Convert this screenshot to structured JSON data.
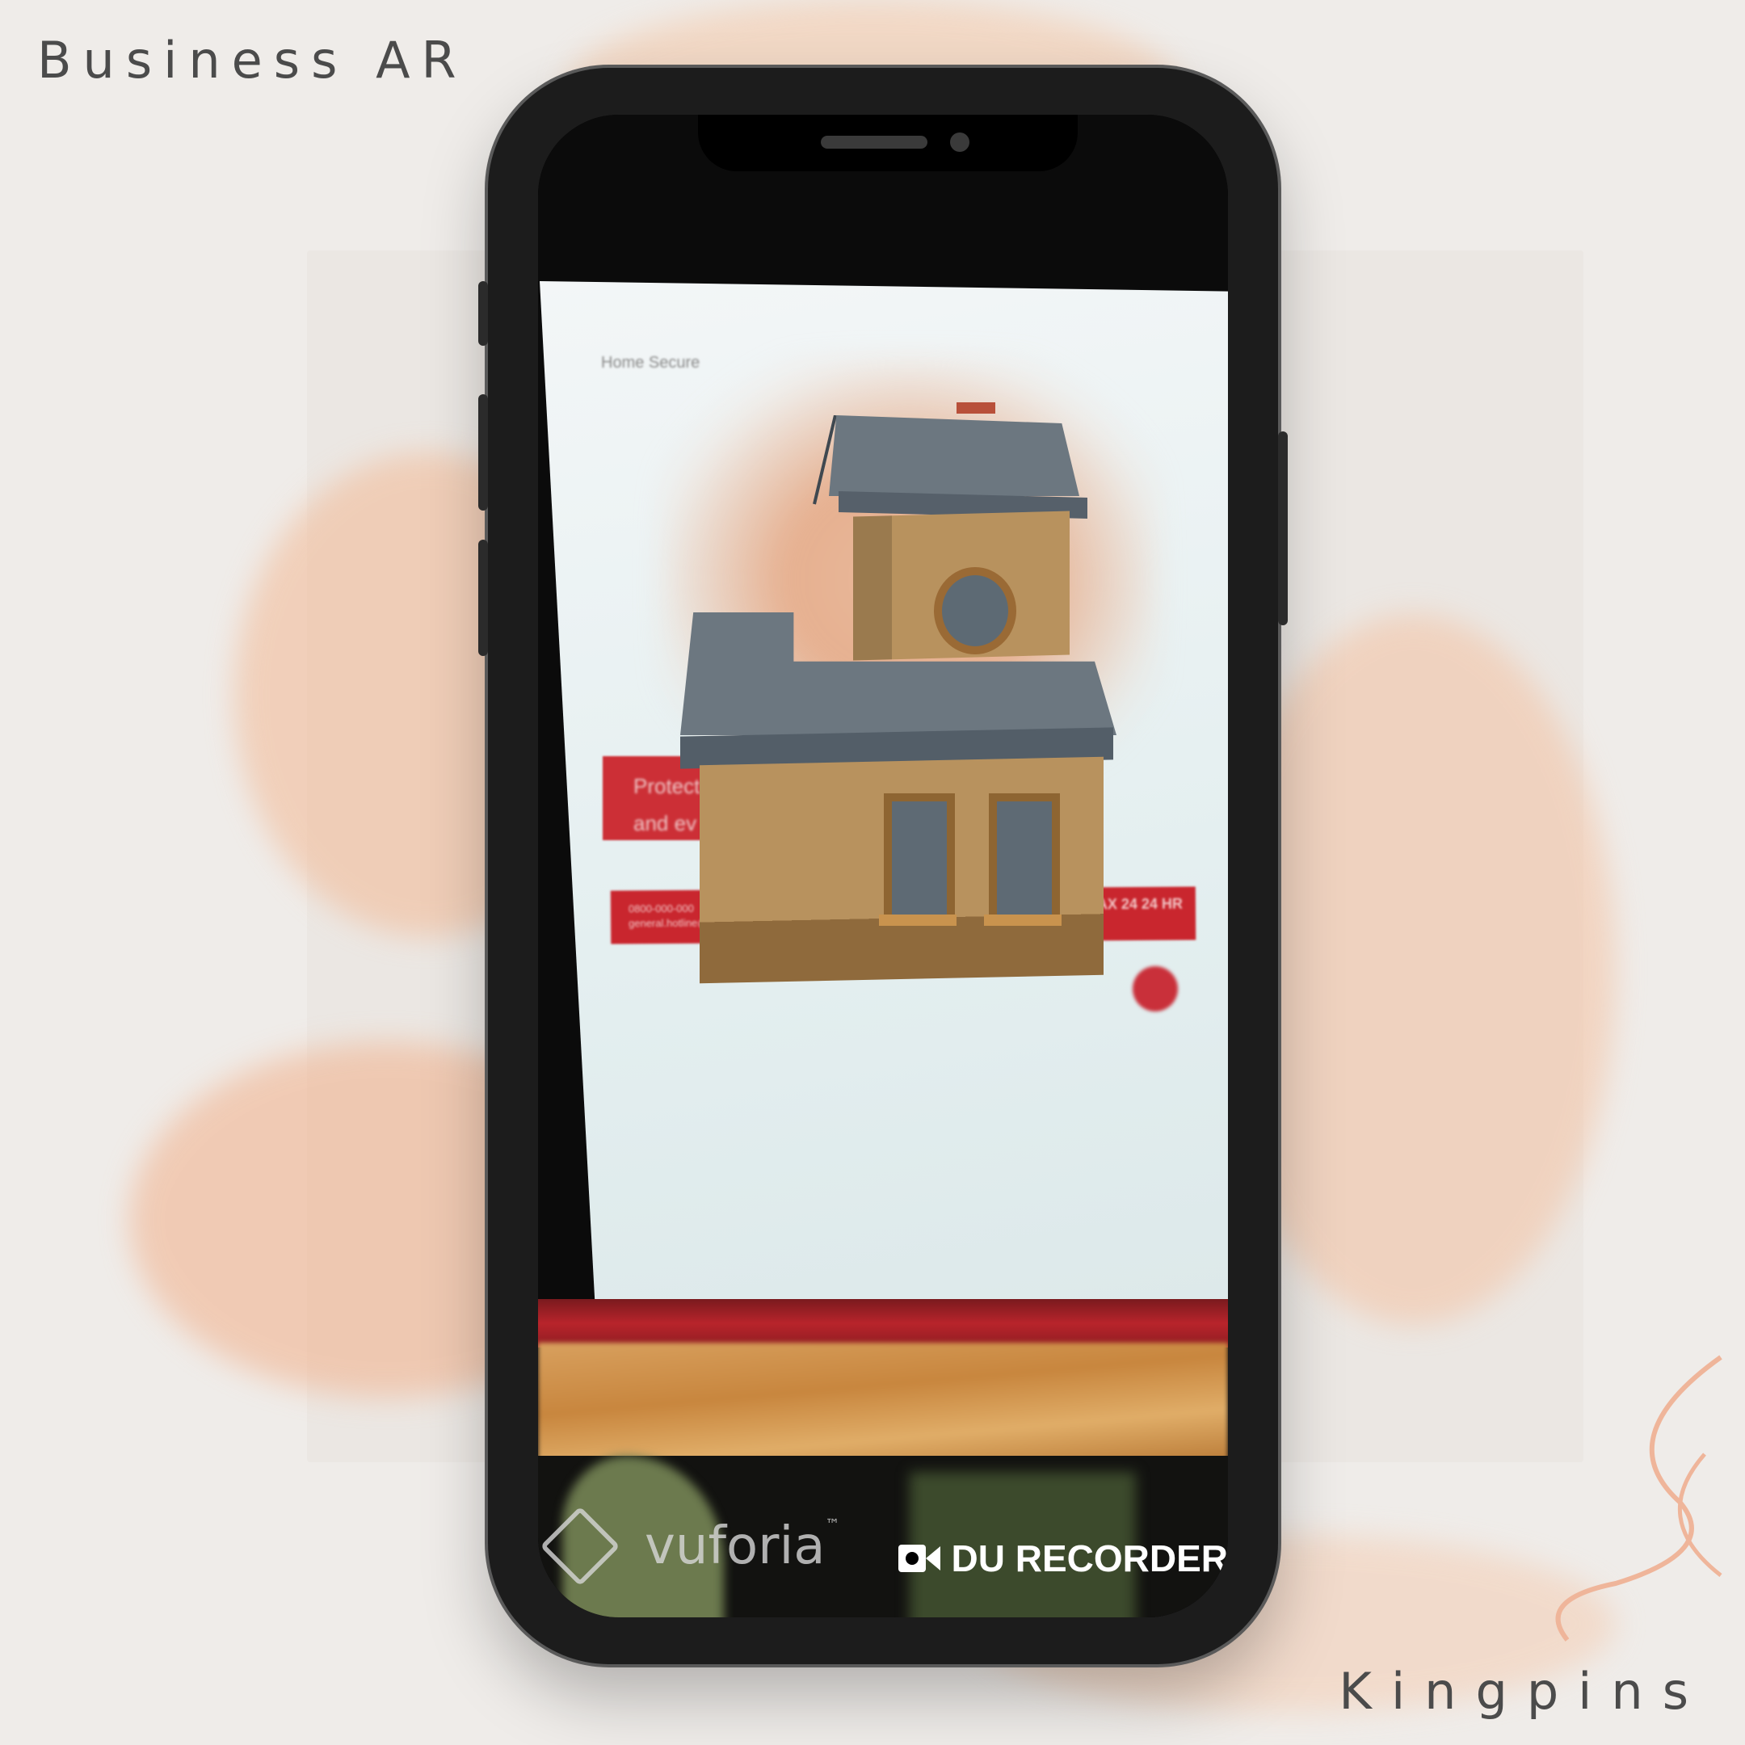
{
  "corner_title": "Business AR",
  "corner_brand": "Kingpins",
  "screen": {
    "brochure": {
      "logo_text": "Home Secure",
      "red_box_line1": "Protect",
      "red_box_line2": "and ev",
      "contact_line1": "0800-000-000",
      "contact_line2": "general.hotline@example.in",
      "badge_text": "MAX 24 24 HR"
    },
    "watermark_left": "vuforia",
    "watermark_left_tm": "™",
    "watermark_right": "DU RECORDER"
  },
  "colors": {
    "background": "#efece9",
    "accent_stroke": "#f2b48f",
    "phone_frame": "#1c1c1c",
    "brochure_red": "#c9262e"
  },
  "icons": [
    "vuforia-logo-icon",
    "video-camera-icon"
  ]
}
